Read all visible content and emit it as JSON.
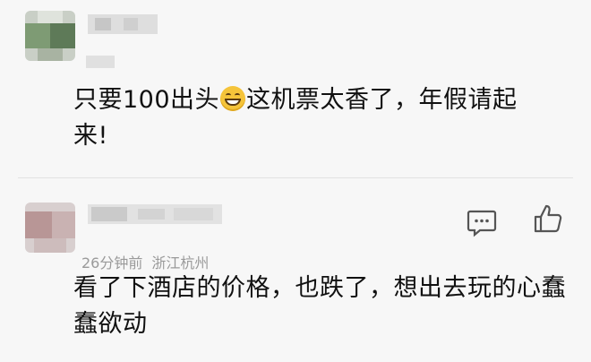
{
  "comments": [
    {
      "text_before_emoji": "只要100出头",
      "emoji": "grinning-face-icon",
      "text_after_emoji": "这机票太香了，年假请起来!"
    },
    {
      "time": "26分钟前",
      "location": "浙江杭州",
      "text": "看了下酒店的价格，也跌了，想出去玩的心蠢蠢欲动",
      "actions": [
        "comment-icon",
        "like-icon"
      ]
    }
  ],
  "colors": {
    "background": "#f7f7f7",
    "text": "#111111",
    "meta": "#9a9a9a",
    "icon": "#555555"
  }
}
